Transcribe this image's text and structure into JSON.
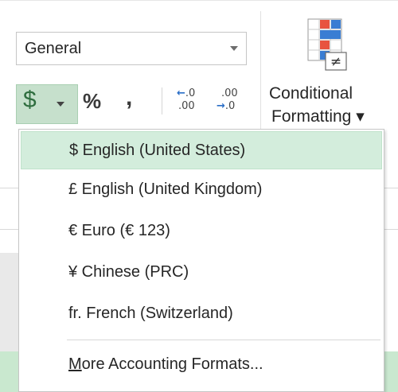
{
  "ribbon": {
    "number_format": {
      "value": "General"
    },
    "accounting_button": {
      "symbol": "$"
    },
    "percent_label": "%",
    "comma_label": " ʼ",
    "increase_decimal": {
      "top": ".0",
      "bottom": ".00",
      "arrow": "←"
    },
    "decrease_decimal": {
      "top": ".00",
      "bottom": ".0",
      "arrow": "→"
    },
    "conditional_formatting": {
      "line1": "Conditional",
      "line2": "Formatting",
      "dropdown_glyph": "▾"
    }
  },
  "menu": {
    "items": [
      {
        "label": "$ English (United States)",
        "highlighted": true
      },
      {
        "label": "£ English (United Kingdom)",
        "highlighted": false
      },
      {
        "label": "€ Euro (€ 123)",
        "highlighted": false
      },
      {
        "label": "¥ Chinese (PRC)",
        "highlighted": false
      },
      {
        "label": "fr. French (Switzerland)",
        "highlighted": false
      }
    ],
    "more_formats": {
      "accel": "M",
      "rest": "ore Accounting Formats..."
    }
  },
  "colors": {
    "highlight": "#d3eddc",
    "accent_green": "#1d7a3c",
    "cf_red": "#e8533f",
    "cf_blue": "#3a7dd3"
  }
}
